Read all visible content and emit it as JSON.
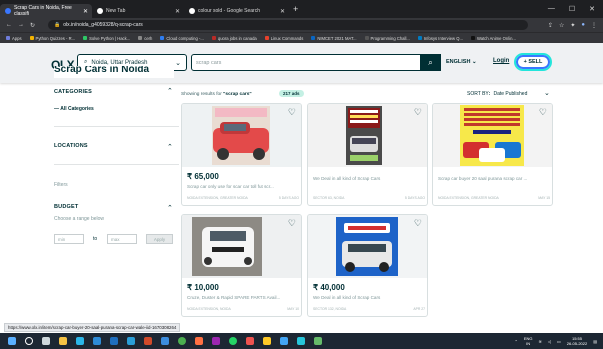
{
  "browser": {
    "tabs": [
      {
        "title": "Scrap Cars in Noida, Free classifi",
        "active": true,
        "favicon_color": "#3a77ff"
      },
      {
        "title": "New Tab",
        "active": false,
        "favicon_color": "#ffffff"
      },
      {
        "title": "colour sold - Google Search",
        "active": false,
        "favicon_color": "#ffffff"
      }
    ],
    "url": "olx.in/noida_g4059328/q-scrap-cars",
    "bookmarks": [
      {
        "label": "Apps",
        "color": "#6f7ddc"
      },
      {
        "label": "Python Quizzes - R...",
        "color": "#f4b400"
      },
      {
        "label": "Solve Python | Hack...",
        "color": "#2ec866"
      },
      {
        "label": "cerh",
        "color": "#888"
      },
      {
        "label": "Cloud computing -...",
        "color": "#2e7df0"
      },
      {
        "label": "quora jobs in canada",
        "color": "#b92b27"
      },
      {
        "label": "Linux Commands",
        "color": "#e8412c"
      },
      {
        "label": "NIMCET 2021 MAT...",
        "color": "#0a66c2"
      },
      {
        "label": "Programming Chall...",
        "color": "#555"
      },
      {
        "label": "Infosys Interview Q...",
        "color": "#007cc3"
      },
      {
        "label": "Watch Anime Onlin...",
        "color": "#111"
      }
    ],
    "status_url": "https://www.olx.in/item/scrap-car-buyer-20-saal-purana-scrap-car-wale-iid-1670308264"
  },
  "header": {
    "logo": "OLX",
    "location": "Noida, Uttar Pradesh",
    "search_placeholder": "scrap cars",
    "language": "ENGLISH",
    "login": "Login",
    "sell": "+ SELL"
  },
  "page_title": "Scrap Cars in Noida",
  "sidebar": {
    "categories_heading": "CATEGORIES",
    "all_categories": "All Categories",
    "locations_heading": "LOCATIONS",
    "filters_label": "Filters",
    "budget_heading": "BUDGET",
    "choose_range": "Choose a range below",
    "min_placeholder": "min",
    "to_label": "to",
    "max_placeholder": "max",
    "apply_label": "Apply"
  },
  "results": {
    "showing_prefix": "Showing results for",
    "query": "\"scrap cars\"",
    "ads_count": "217 ads",
    "sort_label": "SORT BY",
    "sort_value": "Date Published"
  },
  "listings": [
    {
      "price": "₹ 65,000",
      "title": "Scrap car only use for scar car toll fut scr...",
      "location": "Noida Extension, Greater Noida",
      "date": "5 days ago",
      "image": "red-scrap-car"
    },
    {
      "price": "",
      "title": "We Deal in all kind of Scrap Cars",
      "location": "Sector 63, Noida",
      "date": "5 days ago",
      "image": "scrap-buyer-ad-car"
    },
    {
      "price": "",
      "title": "Scrap car buyer 20 saal purana scrap car ...",
      "location": "Noida Extension, Greater Noida",
      "date": "May 15",
      "image": "yellow-poster-cars"
    },
    {
      "price": "₹ 10,000",
      "title": "Cruze, Duster & Rapid SPARE PARTS Avail...",
      "location": "Noida Extension, Noida",
      "date": "May 10",
      "image": "white-car-parts"
    },
    {
      "price": "₹ 40,000",
      "title": "We Deal in all kind of Scrap Cars",
      "location": "Sector 132, Noida",
      "date": "Apr 27",
      "image": "blue-banner-car"
    }
  ],
  "taskbar": {
    "lang": "ENG",
    "region": "IN",
    "time": "15:55",
    "date": "26-05-2022"
  }
}
